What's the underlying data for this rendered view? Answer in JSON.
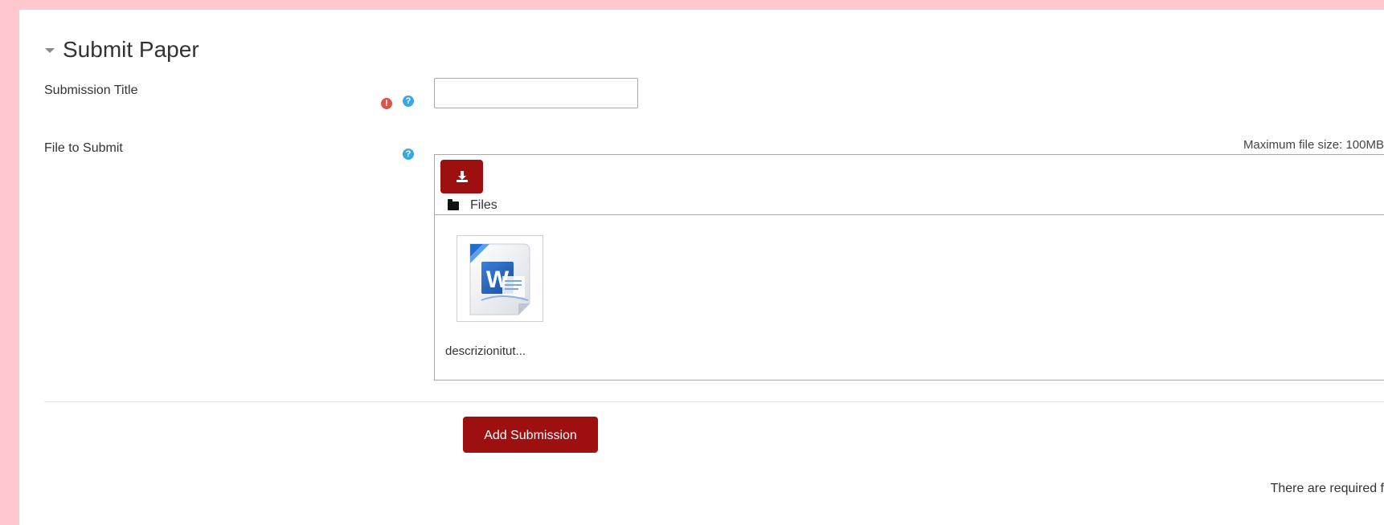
{
  "section": {
    "title": "Submit Paper"
  },
  "fields": {
    "submission_title": {
      "label": "Submission Title",
      "value": "",
      "required_icon": "exclamation-circle-icon",
      "help_icon": "question-circle-icon"
    },
    "file_to_submit": {
      "label": "File to Submit",
      "help_icon": "question-circle-icon",
      "max_size": "Maximum file size: 100MB",
      "path_label": "Files",
      "files": [
        {
          "name": "descrizionitut...",
          "icon": "word-document-icon"
        }
      ]
    }
  },
  "actions": {
    "submit_label": "Add Submission"
  },
  "footer": {
    "required_note": "There are required f"
  },
  "colors": {
    "accent": "#9e1010",
    "help": "#3aa8e0",
    "required": "#d9534f",
    "background": "#ffc8cf"
  }
}
